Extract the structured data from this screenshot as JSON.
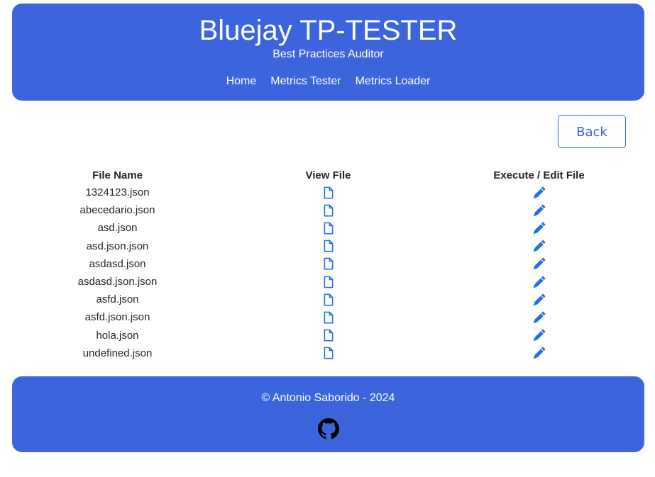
{
  "header": {
    "title": "Bluejay TP-TESTER",
    "subtitle": "Best Practices Auditor",
    "nav": [
      "Home",
      "Metrics Tester",
      "Metrics Loader"
    ]
  },
  "back_label": "Back",
  "table": {
    "headers": [
      "File Name",
      "View File",
      "Execute / Edit File"
    ],
    "view_icon": "file-icon",
    "edit_icon": "pencil-icon",
    "files": [
      "1324123.json",
      "abecedario.json",
      "asd.json",
      "asd.json.json",
      "asdasd.json",
      "asdasd.json.json",
      "asfd.json",
      "asfd.json.json",
      "hola.json",
      "undefined.json"
    ]
  },
  "footer": {
    "copyright": "© Antonio Saborido - 2024",
    "github_icon": "github-icon"
  },
  "colors": {
    "brand": "#3c64dc",
    "icon": "#1f6ff0",
    "text": "#212529"
  }
}
